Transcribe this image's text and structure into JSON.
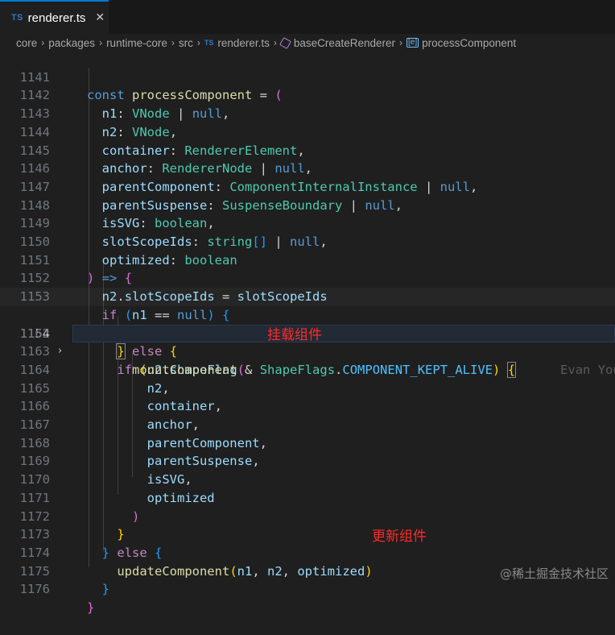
{
  "tab": {
    "lang_badge": "TS",
    "filename": "renderer.ts",
    "close_glyph": "✕"
  },
  "breadcrumb": {
    "items": [
      "core",
      "packages",
      "runtime-core",
      "src",
      "renderer.ts",
      "baseCreateRenderer",
      "processComponent"
    ],
    "file_badge": "TS",
    "separator": "›"
  },
  "editor": {
    "active_line": "1154",
    "blame": "Evan You,",
    "lines": [
      "1141",
      "1142",
      "1143",
      "1144",
      "1145",
      "1146",
      "1147",
      "1148",
      "1149",
      "1150",
      "1151",
      "1152",
      "1153",
      "1154",
      "1162",
      "1163",
      "1164",
      "1165",
      "1166",
      "1167",
      "1168",
      "1169",
      "1170",
      "1171",
      "1172",
      "1173",
      "1174",
      "1175",
      "1176"
    ]
  },
  "annotations": {
    "mount": "挂载组件",
    "update": "更新组件"
  },
  "watermark": "@稀土掘金技术社区",
  "colors": {
    "background": "#1f1f1f",
    "keyword": "#569cd6",
    "control": "#c586c0",
    "function": "#dcdcaa",
    "variable": "#9cdcfe",
    "type": "#4ec9b0",
    "constant": "#4fc1ff",
    "annotation": "#ff2a2a"
  }
}
